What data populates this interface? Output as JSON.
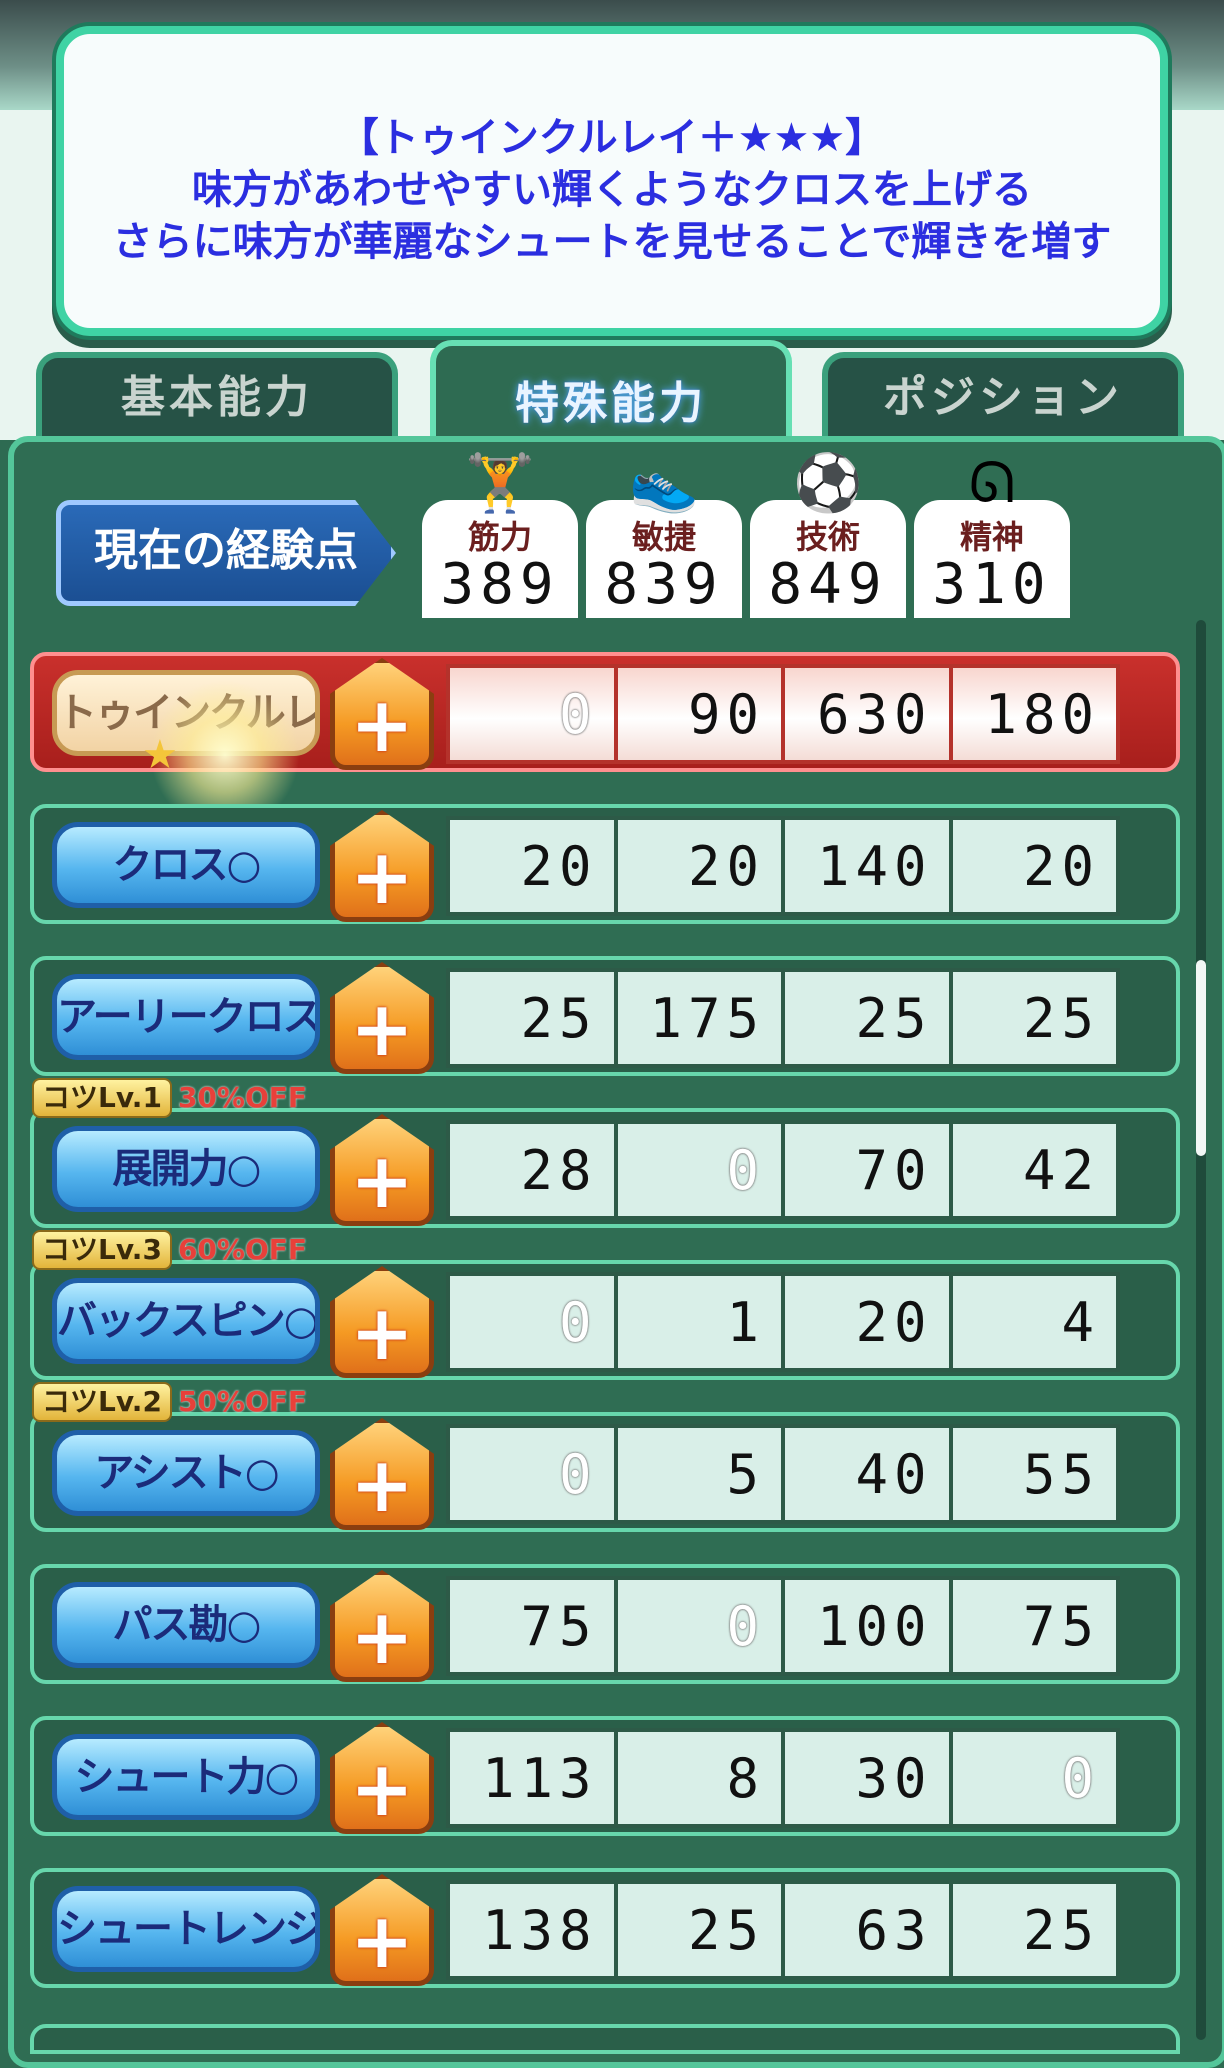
{
  "tooltip": {
    "line1": "【トゥインクルレイ＋★★★】",
    "line2": "味方があわせやすい輝くようなクロスを上げる",
    "line3": "さらに味方が華麗なシュートを見せることで輝きを増す"
  },
  "tabs": [
    {
      "label": "基本能力",
      "active": false
    },
    {
      "label": "特殊能力",
      "active": true
    },
    {
      "label": "ポジション",
      "active": false
    }
  ],
  "experience": {
    "label": "現在の経験点",
    "stats": [
      {
        "icon": "barbell-icon",
        "name": "筋力",
        "value": "389"
      },
      {
        "icon": "shoe-icon",
        "name": "敏捷",
        "value": "839"
      },
      {
        "icon": "ball-icon",
        "name": "技術",
        "value": "849"
      },
      {
        "icon": "spirit-flame-icon",
        "name": "精神",
        "value": "310"
      }
    ]
  },
  "plus_symbol": "+",
  "skills": [
    {
      "name": "トゥインクルレイ",
      "koto_level": "",
      "discount": "",
      "costs": [
        "0",
        "90",
        "630",
        "180"
      ],
      "highlight": true
    },
    {
      "name": "クロス○",
      "koto_level": "",
      "discount": "",
      "costs": [
        "20",
        "20",
        "140",
        "20"
      ],
      "highlight": false
    },
    {
      "name": "アーリークロス○",
      "koto_level": "",
      "discount": "",
      "costs": [
        "25",
        "175",
        "25",
        "25"
      ],
      "highlight": false
    },
    {
      "name": "展開力○",
      "koto_level": "コツLv.1",
      "discount": "30%OFF",
      "costs": [
        "28",
        "0",
        "70",
        "42"
      ],
      "highlight": false
    },
    {
      "name": "バックスピン○",
      "koto_level": "コツLv.3",
      "discount": "60%OFF",
      "costs": [
        "0",
        "1",
        "20",
        "4"
      ],
      "highlight": false
    },
    {
      "name": "アシスト○",
      "koto_level": "コツLv.2",
      "discount": "50%OFF",
      "costs": [
        "0",
        "5",
        "40",
        "55"
      ],
      "highlight": false
    },
    {
      "name": "パス勘○",
      "koto_level": "",
      "discount": "",
      "costs": [
        "75",
        "0",
        "100",
        "75"
      ],
      "highlight": false
    },
    {
      "name": "シュート力○",
      "koto_level": "",
      "discount": "",
      "costs": [
        "113",
        "8",
        "30",
        "0"
      ],
      "highlight": false
    },
    {
      "name": "シュートレンジ○",
      "koto_level": "",
      "discount": "",
      "costs": [
        "138",
        "25",
        "63",
        "25"
      ],
      "highlight": false
    }
  ],
  "colors": {
    "tooltip_text": "#2b2ee0",
    "highlight_row": "#c9302c",
    "skill_button": "#56b6ef",
    "plus_button": "#f59a23",
    "discount_text": "#e8403a"
  }
}
